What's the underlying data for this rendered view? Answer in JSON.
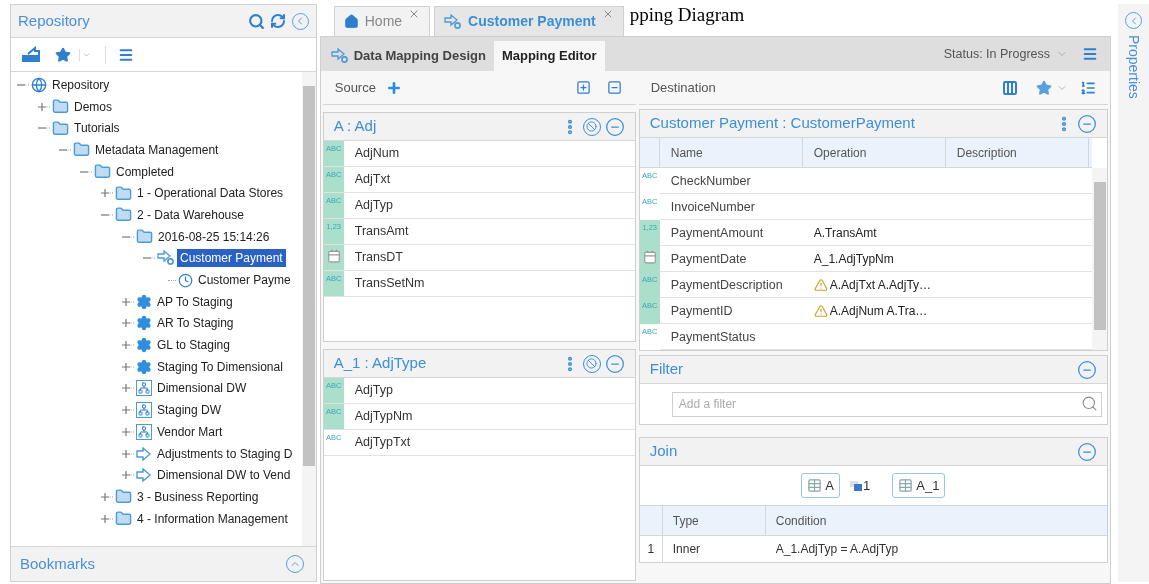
{
  "caption_fragment": "pping Diagram",
  "repository": {
    "title": "Repository",
    "tree": [
      {
        "label": "Repository",
        "kind": "globe",
        "expanded": true,
        "selected": false,
        "children": [
          {
            "label": "Demos",
            "kind": "folder",
            "expanded": false,
            "selected": false
          },
          {
            "label": "Tutorials",
            "kind": "folder",
            "expanded": true,
            "selected": false,
            "children": [
              {
                "label": "Metadata Management",
                "kind": "folder",
                "expanded": true,
                "selected": false,
                "children": [
                  {
                    "label": "Completed",
                    "kind": "folder",
                    "expanded": true,
                    "selected": false,
                    "children": [
                      {
                        "label": "1 - Operational Data Stores",
                        "kind": "folder",
                        "expanded": false,
                        "selected": false
                      },
                      {
                        "label": "2 - Data Warehouse",
                        "kind": "folder",
                        "expanded": true,
                        "selected": false,
                        "children": [
                          {
                            "label": "2016-08-25 15:14:26",
                            "kind": "folder",
                            "expanded": true,
                            "selected": false,
                            "children": [
                              {
                                "label": "Customer Payment",
                                "kind": "mapping",
                                "expanded": true,
                                "selected": true,
                                "children": [
                                  {
                                    "label": "Customer Payme",
                                    "kind": "clock",
                                    "selected": false
                                  }
                                ]
                              }
                            ]
                          },
                          {
                            "label": "AP To Staging",
                            "kind": "gear",
                            "expanded": false,
                            "selected": false
                          },
                          {
                            "label": "AR To Staging",
                            "kind": "gear",
                            "expanded": false,
                            "selected": false
                          },
                          {
                            "label": "GL to Staging",
                            "kind": "gear",
                            "expanded": false,
                            "selected": false
                          },
                          {
                            "label": "Staging To Dimensional",
                            "kind": "gear",
                            "expanded": false,
                            "selected": false
                          },
                          {
                            "label": "Dimensional DW",
                            "kind": "model",
                            "expanded": false,
                            "selected": false
                          },
                          {
                            "label": "Staging DW",
                            "kind": "model",
                            "expanded": false,
                            "selected": false
                          },
                          {
                            "label": "Vendor Mart",
                            "kind": "model",
                            "expanded": false,
                            "selected": false
                          },
                          {
                            "label": "Adjustments to Staging D",
                            "kind": "arrow",
                            "expanded": false,
                            "selected": false
                          },
                          {
                            "label": "Dimensional DW to Vend",
                            "kind": "arrow",
                            "expanded": false,
                            "selected": false
                          }
                        ]
                      },
                      {
                        "label": "3 - Business Reporting",
                        "kind": "folder",
                        "expanded": false,
                        "selected": false
                      },
                      {
                        "label": "4 - Information Management",
                        "kind": "folder",
                        "expanded": false,
                        "selected": false
                      }
                    ]
                  }
                ]
              }
            ]
          }
        ]
      }
    ]
  },
  "bookmarks": {
    "title": "Bookmarks"
  },
  "tabs": [
    {
      "label": "Home",
      "kind": "home",
      "selected": false
    },
    {
      "label": "Customer Payment",
      "kind": "mapping",
      "selected": true
    }
  ],
  "subtabs": [
    {
      "label": "Data Mapping Design",
      "kind": "mapping",
      "selected": false
    },
    {
      "label": "Mapping Editor",
      "kind": "plain",
      "selected": true
    }
  ],
  "status": "Status: In Progress",
  "source": {
    "title": "Source",
    "tables": [
      {
        "title": "A : Adj",
        "fields": [
          {
            "name": "AdjNum",
            "kind": "text",
            "type_label": "ABC",
            "mapped": true
          },
          {
            "name": "AdjTxt",
            "kind": "text",
            "type_label": "ABC",
            "mapped": true
          },
          {
            "name": "AdjTyp",
            "kind": "text",
            "type_label": "ABC",
            "mapped": true
          },
          {
            "name": "TransAmt",
            "kind": "number",
            "type_label": "1,23",
            "mapped": true
          },
          {
            "name": "TransDT",
            "kind": "date",
            "mapped": true
          },
          {
            "name": "TransSetNm",
            "kind": "text",
            "type_label": "ABC",
            "mapped": true
          }
        ]
      },
      {
        "title": "A_1 : AdjType",
        "fields": [
          {
            "name": "AdjTyp",
            "kind": "text",
            "type_label": "ABC",
            "mapped": true
          },
          {
            "name": "AdjTypNm",
            "kind": "text",
            "type_label": "ABC",
            "mapped": true
          },
          {
            "name": "AdjTypTxt",
            "kind": "text",
            "type_label": "ABC",
            "mapped": false
          }
        ]
      }
    ]
  },
  "destination": {
    "title": "Destination",
    "table": {
      "title": "Customer Payment : CustomerPayment",
      "columns": [
        "Name",
        "Operation",
        "Description"
      ],
      "rows": [
        {
          "name": "CheckNumber",
          "kind": "text",
          "type_label": "ABC",
          "mapped": false
        },
        {
          "name": "InvoiceNumber",
          "kind": "text",
          "type_label": "ABC",
          "mapped": false
        },
        {
          "name": "PaymentAmount",
          "kind": "number",
          "type_label": "1,23",
          "mapped": true,
          "operation": "A.TransAmt",
          "warning": false
        },
        {
          "name": "PaymentDate",
          "kind": "date",
          "mapped": true,
          "operation": "A_1.AdjTypNm",
          "warning": false
        },
        {
          "name": "PaymentDescription",
          "kind": "text",
          "type_label": "ABC",
          "mapped": true,
          "operation": "A.AdjTxt A.AdjTy…",
          "warning": true
        },
        {
          "name": "PaymentID",
          "kind": "text",
          "type_label": "ABC",
          "mapped": true,
          "operation": "A.AdjNum A.Tra…",
          "warning": true
        },
        {
          "name": "PaymentStatus",
          "kind": "text",
          "type_label": "ABC",
          "mapped": false
        }
      ]
    }
  },
  "filter": {
    "title": "Filter",
    "placeholder": "Add a filter"
  },
  "join": {
    "title": "Join",
    "left": "A",
    "count": "1",
    "right": "A_1",
    "columns": [
      "Type",
      "Condition"
    ],
    "rows": [
      {
        "index": "1",
        "type": "Inner",
        "condition": "A_1.AdjTyp = A.AdjTyp"
      }
    ]
  },
  "properties": {
    "title": "Properties"
  }
}
